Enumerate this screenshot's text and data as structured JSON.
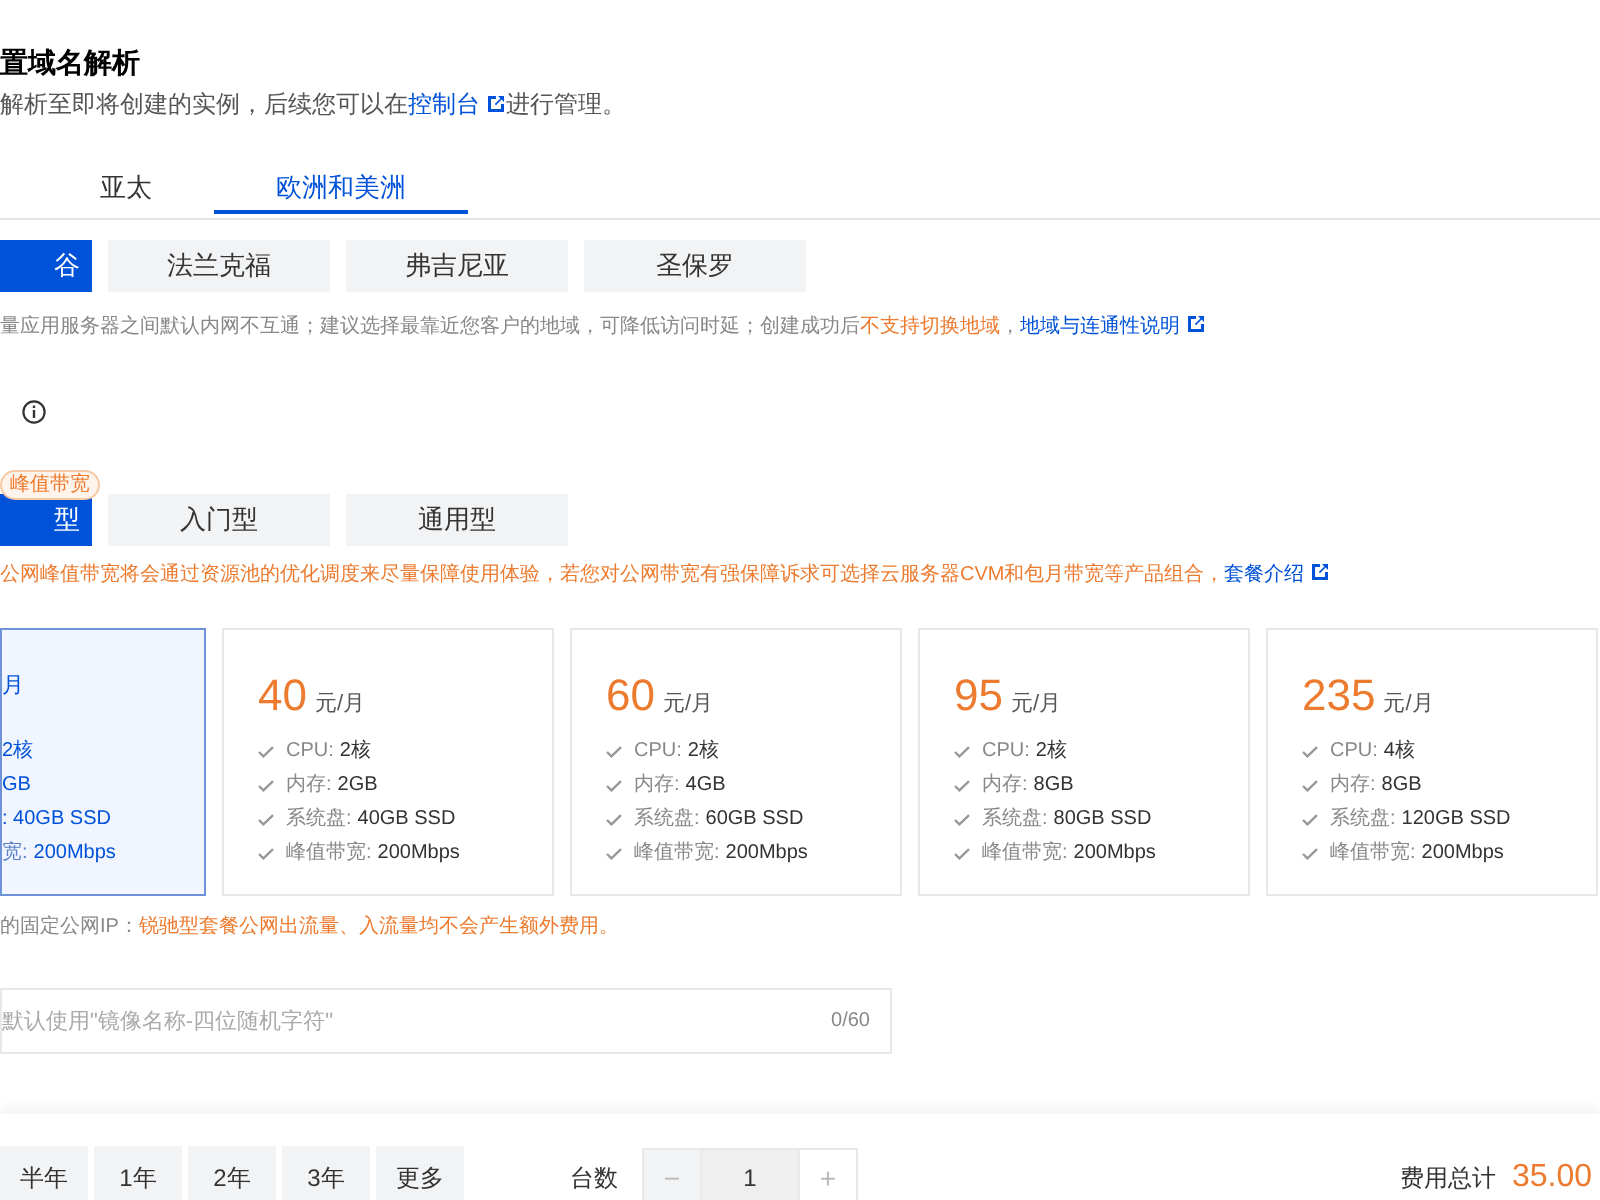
{
  "section_title": "置域名解析",
  "description": {
    "before": "解析至即将创建的实例，后续您可以在",
    "link": "控制台",
    "after": "进行管理。"
  },
  "region_tabs": [
    {
      "label": "亚太",
      "selected": false
    },
    {
      "label": "欧洲和美洲",
      "selected": true
    }
  ],
  "regions": [
    {
      "label": "谷",
      "selected": true
    },
    {
      "label": "法兰克福",
      "selected": false
    },
    {
      "label": "弗吉尼亚",
      "selected": false
    },
    {
      "label": "圣保罗",
      "selected": false
    }
  ],
  "region_note": {
    "text": "量应用服务器之间默认内网不互通；建议选择最靠近您客户的地域，可降低访问时延；创建成功后",
    "warning": "不支持切换地域",
    "separator": "，",
    "link": "地域与连通性说明"
  },
  "plan_types": [
    {
      "label": "型",
      "selected": true,
      "badge": "峰值带宽"
    },
    {
      "label": "入门型",
      "selected": false
    },
    {
      "label": "通用型",
      "selected": false
    }
  ],
  "plan_note": {
    "text": "公网峰值带宽将会通过资源池的优化调度来尽量保障使用体验，若您对公网带宽有强保障诉求可选择云服务器CVM和包月带宽等产品组合，",
    "link": "套餐介绍"
  },
  "plans": [
    {
      "kind": "partial",
      "selected": true,
      "unit": "月",
      "specs": [
        {
          "value": "2核"
        },
        {
          "value": "GB"
        },
        {
          "value": ": 40GB SSD"
        },
        {
          "label": "宽:",
          "value": "200Mbps"
        }
      ]
    },
    {
      "kind": "full",
      "selected": false,
      "price": "40",
      "unit": "元/月",
      "specs": [
        {
          "label": "CPU:",
          "value": "2核"
        },
        {
          "label": "内存:",
          "value": "2GB"
        },
        {
          "label": "系统盘:",
          "value": "40GB SSD"
        },
        {
          "label": "峰值带宽:",
          "value": "200Mbps"
        }
      ]
    },
    {
      "kind": "full",
      "selected": false,
      "price": "60",
      "unit": "元/月",
      "specs": [
        {
          "label": "CPU:",
          "value": "2核"
        },
        {
          "label": "内存:",
          "value": "4GB"
        },
        {
          "label": "系统盘:",
          "value": "60GB SSD"
        },
        {
          "label": "峰值带宽:",
          "value": "200Mbps"
        }
      ]
    },
    {
      "kind": "full",
      "selected": false,
      "price": "95",
      "unit": "元/月",
      "specs": [
        {
          "label": "CPU:",
          "value": "2核"
        },
        {
          "label": "内存:",
          "value": "8GB"
        },
        {
          "label": "系统盘:",
          "value": "80GB SSD"
        },
        {
          "label": "峰值带宽:",
          "value": "200Mbps"
        }
      ]
    },
    {
      "kind": "full",
      "selected": false,
      "price": "235",
      "unit": "元/月",
      "specs": [
        {
          "label": "CPU:",
          "value": "4核"
        },
        {
          "label": "内存:",
          "value": "8GB"
        },
        {
          "label": "系统盘:",
          "value": "120GB SSD"
        },
        {
          "label": "峰值带宽:",
          "value": "200Mbps"
        }
      ]
    }
  ],
  "ip_note": {
    "text": "的固定公网IP：",
    "warning": "锐驰型套餐公网出流量、入流量均不会产生额外费用。"
  },
  "name_field": {
    "placeholder": "默认使用\"镜像名称-四位随机字符\"",
    "counter": "0/60"
  },
  "durations": [
    {
      "label": "半年",
      "selected": false
    },
    {
      "label": "1年",
      "selected": false
    },
    {
      "label": "2年",
      "selected": false
    },
    {
      "label": "3年",
      "selected": false
    },
    {
      "label": "更多",
      "selected": false
    }
  ],
  "quantity": {
    "label": "台数",
    "minus": "−",
    "value": "1",
    "plus": "+"
  },
  "total": {
    "label": "费用总计",
    "amount": "35.00"
  }
}
